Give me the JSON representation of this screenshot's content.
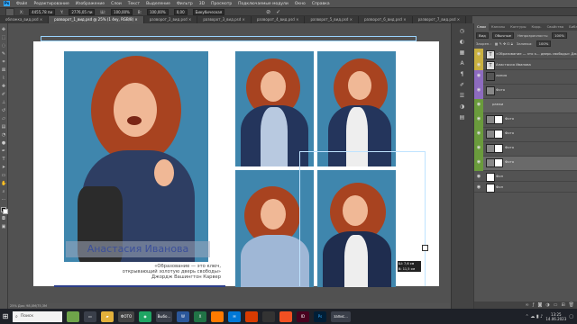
{
  "menubar": {
    "logo": "Ps",
    "items": [
      "Файл",
      "Редактирование",
      "Изображение",
      "Слои",
      "Текст",
      "Выделение",
      "Фильтр",
      "3D",
      "Просмотр",
      "Подключаемые модули",
      "Окно",
      "Справка"
    ]
  },
  "optionsbar": {
    "x_label": "X:",
    "x_value": "4455,78 пи",
    "y_label": "Y:",
    "y_value": "2776,05 пи",
    "w_label": "Ш:",
    "w_value": "100,00%",
    "h_label": "В:",
    "h_value": "100,00%",
    "angle_value": "0,00",
    "interp": "Бикубическая"
  },
  "tabs": [
    {
      "label": "обложка_вид.psd ×",
      "active": false
    },
    {
      "label": "разворот_1_вид.psd @ 25% (1 4ку, RGB/8) ×",
      "active": true
    },
    {
      "label": "разворот_2_вид.psd ×",
      "active": false
    },
    {
      "label": "разворот_3_вид.psd ×",
      "active": false
    },
    {
      "label": "разворот_4_вид.psd ×",
      "active": false
    },
    {
      "label": "разворот_5_вид.psd ×",
      "active": false
    },
    {
      "label": "разворот_6_вид.psd ×",
      "active": false
    },
    {
      "label": "разворот_7_вид.psd ×",
      "active": false
    },
    {
      "label": "разворот_8_вид.psd ×",
      "active": false
    }
  ],
  "document": {
    "name_caption": "Анастасия Иванова",
    "quote_lines": [
      "«Образование — это ключ,",
      "открывающий золотую дверь свободы»",
      "Джордж Вашингтон Карвер"
    ],
    "brand_blue": "#2c3e8a",
    "bg_blue": "#3f86ad",
    "hair": "#a84320",
    "measure_w": "Ш: 7,6 см",
    "measure_h": "В: 11,5 см"
  },
  "statusbar": {
    "text": "25%   Док: 98,0М/75,3М"
  },
  "panel": {
    "tabs": [
      "Слои",
      "Каналы",
      "Контуры",
      "Корр.",
      "Свойства",
      "Библ."
    ],
    "search_label": "Вид",
    "blend_mode": "Обычные",
    "opacity_label": "Непрозрачность:",
    "opacity": "100%",
    "lock_label": "Закреп.:",
    "fill_label": "Заливка:",
    "fill": "100%",
    "layers": [
      {
        "name": "«Образование — это к... дверь свободы» Джо",
        "thumb": "T",
        "color": "#c9b040"
      },
      {
        "name": "Анастасия Иванова",
        "thumb": "T",
        "color": "#c9b040"
      },
      {
        "name": "линия",
        "thumb": "",
        "color": "#8d6bbf"
      },
      {
        "name": "Фото",
        "thumb": "",
        "color": "#8d6bbf"
      },
      {
        "name": "рамки",
        "thumb": "",
        "color": "#6a9b3c"
      },
      {
        "name": "Фото",
        "thumb": "",
        "color": "#6a9b3c"
      },
      {
        "name": "Фото",
        "thumb": "",
        "color": "#6a9b3c"
      },
      {
        "name": "Фото",
        "thumb": "",
        "color": "#6a9b3c"
      },
      {
        "name": "Фото",
        "thumb": "",
        "color": "#6a9b3c"
      },
      {
        "name": "Фон",
        "thumb": "",
        "color": ""
      },
      {
        "name": "Фон",
        "thumb": "",
        "color": ""
      }
    ]
  },
  "taskbar": {
    "search_placeholder": "Поиск",
    "apps": [
      "",
      "",
      "",
      "ФОТО",
      "",
      "Выбо...",
      "",
      "",
      "",
      "",
      "",
      "",
      "",
      "",
      "",
      "",
      "",
      "",
      "",
      "ID",
      "Ps",
      "запис..."
    ],
    "time": "13:25",
    "date": "14.06.2023"
  }
}
